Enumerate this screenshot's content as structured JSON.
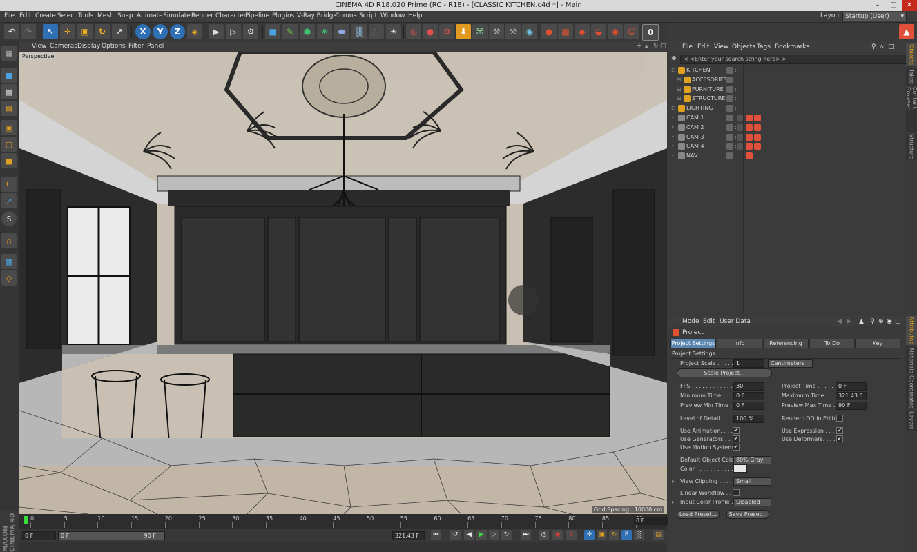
{
  "window": {
    "title": "CINEMA 4D R18.020 Prime (RC - R18) - [CLASSIC KITCHEN.c4d *] - Main"
  },
  "menu": [
    "File",
    "Edit",
    "Create",
    "Select",
    "Tools",
    "Mesh",
    "Snap",
    "Animate",
    "Simulate",
    "Render",
    "Character",
    "Pipeline",
    "Plugins",
    "V-Ray Bridge",
    "Corona",
    "Script",
    "Window",
    "Help"
  ],
  "layout": {
    "label": "Layout:",
    "value": "Startup (User)"
  },
  "toolbar": {
    "axis_x": "X",
    "axis_y": "Y",
    "axis_z": "Z",
    "counter": "0"
  },
  "viewport": {
    "menu": [
      "View",
      "Cameras",
      "Display",
      "Options",
      "Filter",
      "Panel"
    ],
    "label": "Perspective",
    "grid_spacing": "Grid Spacing : 10000 cm"
  },
  "timeline": {
    "ticks": [
      "0",
      "5",
      "10",
      "15",
      "20",
      "25",
      "30",
      "35",
      "40",
      "45",
      "50",
      "55",
      "60",
      "65",
      "70",
      "75",
      "80",
      "85",
      "90"
    ],
    "end_frame": "0 F",
    "current": "0 F",
    "range_start": "0 F",
    "range_end": "90 F",
    "max_time": "321.43 F"
  },
  "object_manager": {
    "menu": [
      "File",
      "Edit",
      "View",
      "Objects",
      "Tags",
      "Bookmarks"
    ],
    "search_placeholder": "< <Enter your search string here> >",
    "objects": [
      {
        "name": "KITCHEN",
        "indent": 0
      },
      {
        "name": "ACCESORIES",
        "indent": 1
      },
      {
        "name": "FURNITURE",
        "indent": 1
      },
      {
        "name": "STRUCTURE",
        "indent": 1
      },
      {
        "name": "LIGHTING",
        "indent": 0
      },
      {
        "name": "CAM 1",
        "indent": 0
      },
      {
        "name": "CAM 2",
        "indent": 0
      },
      {
        "name": "CAM 3",
        "indent": 0
      },
      {
        "name": "CAM 4",
        "indent": 0
      },
      {
        "name": "NAV",
        "indent": 0
      }
    ]
  },
  "right_tabs": {
    "objects": "Objects",
    "takes": "Takes",
    "content_browser": "Content Browser",
    "structure": "Structure",
    "attributes": "Attributes",
    "materials": "Materials",
    "coordinates": "Coordinates",
    "layers": "Layers"
  },
  "attributes": {
    "menu": [
      "Mode",
      "Edit",
      "User Data"
    ],
    "header": "Project",
    "tabs": [
      "Project Settings",
      "Info",
      "Referencing",
      "To Do",
      "Key Interpolation"
    ],
    "section": "Project Settings",
    "project_scale_label": "Project Scale . . . . . .",
    "project_scale": "1",
    "project_scale_unit": "Centimeters",
    "scale_project_button": "Scale Project...",
    "fps_label": "FPS . . . . . . . . . . . . .",
    "fps": "30",
    "project_time_label": "Project Time . . . . . . .",
    "project_time": "0 F",
    "min_time_label": "Minimum Time. . . . . .",
    "min_time": "0 F",
    "max_time_label": "Maximum Time. . . . . .",
    "max_time": "321.43 F",
    "preview_min_label": "Preview Min Time . . .",
    "preview_min": "0 F",
    "preview_max_label": "Preview Max Time . . .",
    "preview_max": "90 F",
    "lod_label": "Level of Detail . . . . .",
    "lod": "100 %",
    "render_lod_label": "Render LOD in Editor",
    "use_animation_label": "Use Animation. . . . .",
    "use_expression_label": "Use Expression . . . . .",
    "use_generators_label": "Use Generators . . . .",
    "use_deformers_label": "Use Deformers. . . . . .",
    "use_motion_label": "Use Motion System",
    "check": "✔",
    "default_color_label": "Default Object Color",
    "default_color": "80% Gray",
    "color_label": "Color . . . . . . . . . . .",
    "view_clipping_label": "View Clipping . . . . . .",
    "view_clipping": "Small",
    "linear_workflow_label": "Linear Workflow . . . .",
    "input_profile_label": "Input Color Profile . . .",
    "input_profile": "Disabled",
    "load_preset": "Load Preset...",
    "save_preset": "Save Preset..."
  },
  "colors": {
    "accent": "#5a86b0",
    "timeline_marker": "#3ddc3d",
    "cam_tag": "#e0503a"
  }
}
